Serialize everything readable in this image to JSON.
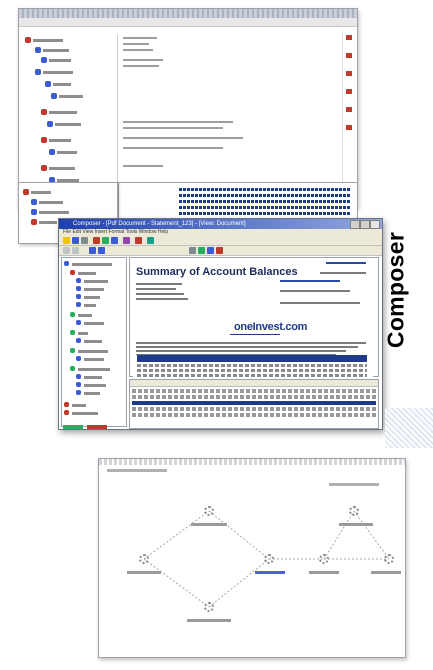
{
  "side_title": "Composer",
  "main_window": {
    "title": "Composer - [Pdf Document - Statement_123] - [View: Document]",
    "menu": "File  Edit  View  Insert  Format  Tools  Window  Help",
    "document_heading": "Summary of Account Balances",
    "logo_text": "oneInvest.com"
  },
  "colors": {
    "accent": "#1e3a8a",
    "titlebar": "#1e40af",
    "toolbar_bg": "#ece9d8",
    "stripe": "#dfe7f2"
  },
  "icons": [
    "folder-icon",
    "document-icon",
    "gear-icon",
    "close-icon",
    "minimize-icon",
    "maximize-icon"
  ]
}
